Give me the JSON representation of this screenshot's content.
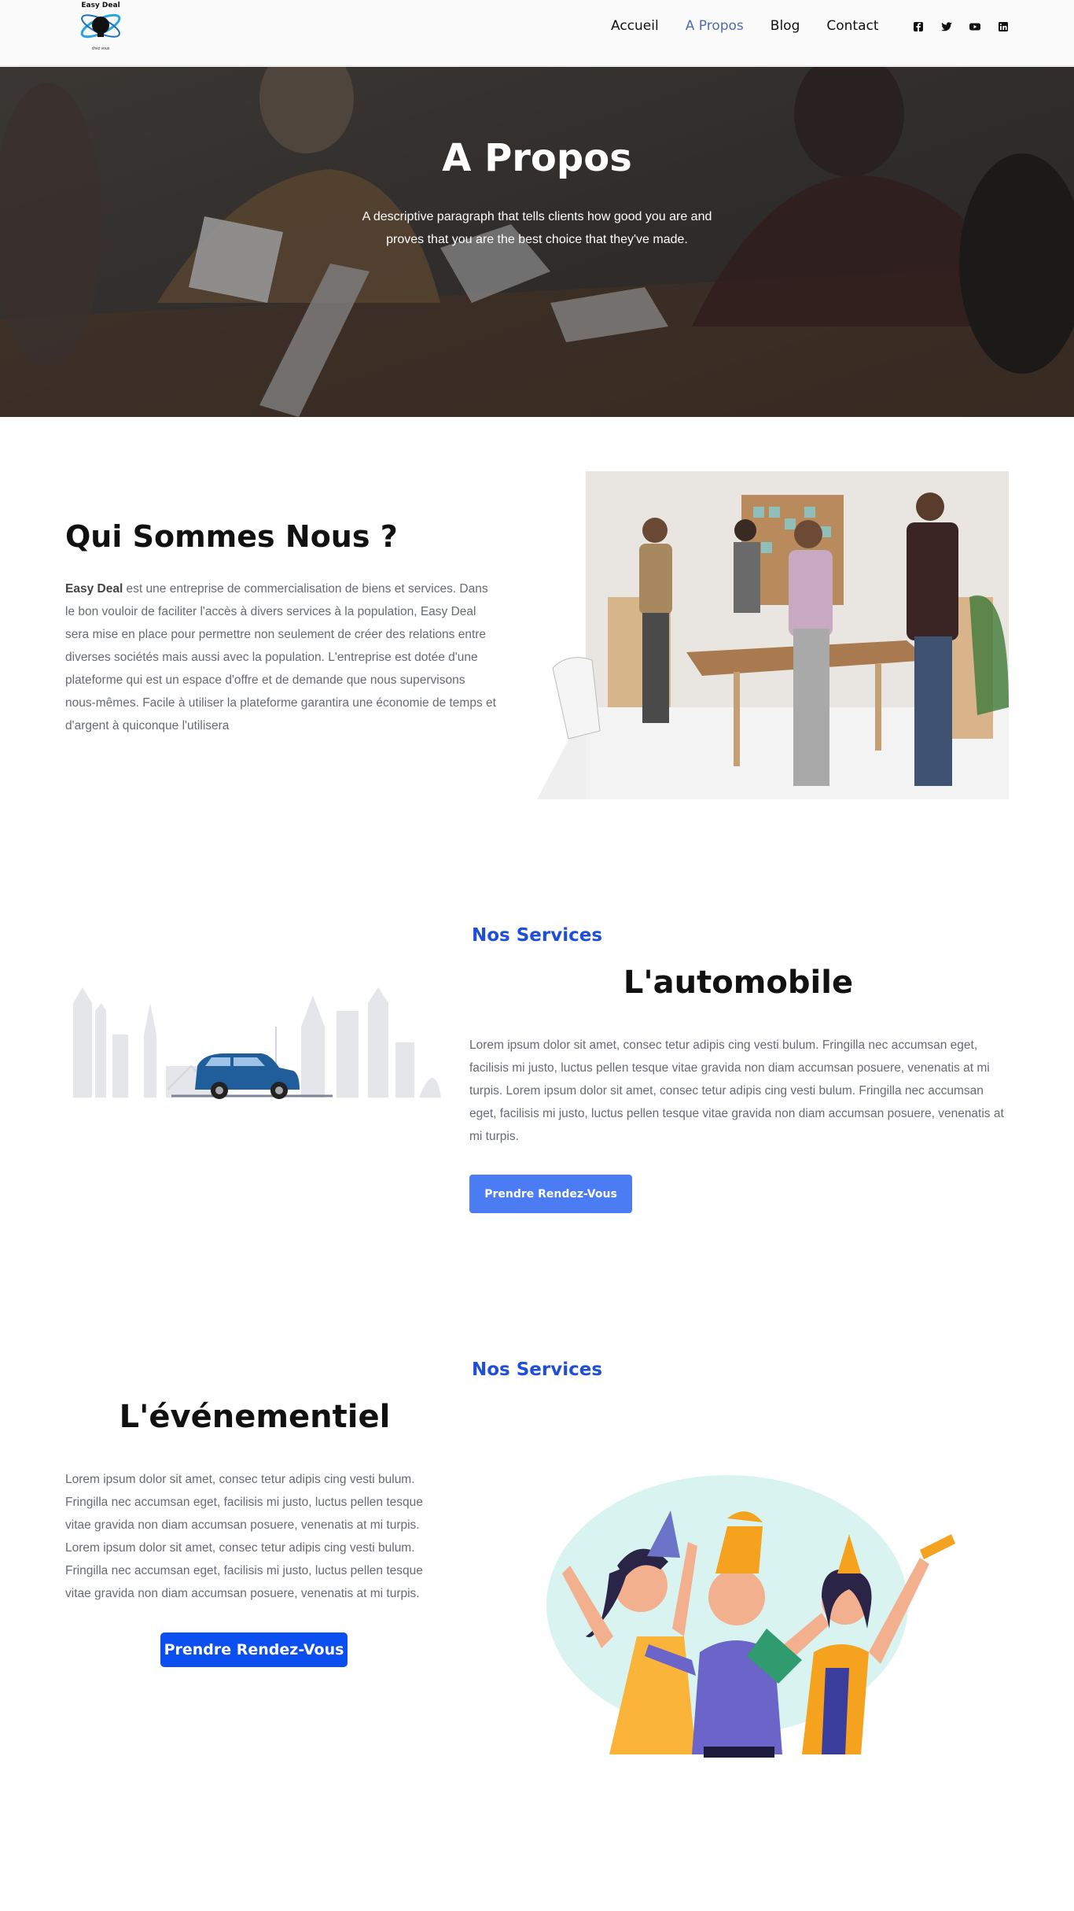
{
  "header": {
    "logo": {
      "name": "Easy Deal",
      "tagline": "chez vous"
    },
    "nav": [
      "Accueil",
      "A Propos",
      "Blog",
      "Contact"
    ],
    "active_nav": "A Propos",
    "socials": [
      "facebook-icon",
      "twitter-icon",
      "youtube-icon",
      "linkedin-icon"
    ]
  },
  "hero": {
    "title": "A Propos",
    "subtitle": "A descriptive paragraph that tells clients how good you are and proves that you are the best choice that they've made."
  },
  "about": {
    "title": "Qui Sommes Nous ?",
    "brand": "Easy Deal",
    "text": " est une entreprise de commercialisation de biens et services. Dans le bon vouloir de faciliter l'accès à divers services à la population, Easy Deal sera mise en place pour permettre non seulement de créer des relations entre diverses sociétés mais aussi avec la population. L'entreprise est dotée d'une plateforme qui est un espace d'offre et de demande que nous supervisons nous-mêmes. Facile à utiliser la plateforme garantira une économie de temps et d'argent à quiconque l'utilisera"
  },
  "services": [
    {
      "label": "Nos Services",
      "title": "L'automobile",
      "text": "Lorem ipsum dolor sit amet, consec tetur adipis cing vesti bulum. Fringilla nec accumsan eget, facilisis mi justo, luctus pellen tesque vitae gravida non diam accumsan posuere, venenatis at mi turpis. Lorem ipsum dolor sit amet, consec tetur adipis cing vesti bulum. Fringilla nec accumsan eget, facilisis mi justo, luctus pellen tesque vitae gravida non diam accumsan posuere, venenatis at mi turpis.",
      "button": "Prendre Rendez-Vous"
    },
    {
      "label": "Nos Services",
      "title": "L'événementiel",
      "text": "Lorem ipsum dolor sit amet, consec tetur adipis cing vesti bulum. Fringilla nec accumsan eget, facilisis mi justo, luctus pellen tesque vitae gravida non diam accumsan posuere, venenatis at mi turpis. Lorem ipsum dolor sit amet, consec tetur adipis cing vesti bulum. Fringilla nec accumsan eget, facilisis mi justo, luctus pellen tesque vitae gravida non diam accumsan posuere, venenatis at mi turpis.",
      "button": "Prendre Rendez-Vous"
    }
  ],
  "colors": {
    "accent": "#1f4fd8",
    "button_light": "#4b7cf3",
    "button_dark": "#0b4ff0",
    "nav_active": "#4e6ab2"
  }
}
